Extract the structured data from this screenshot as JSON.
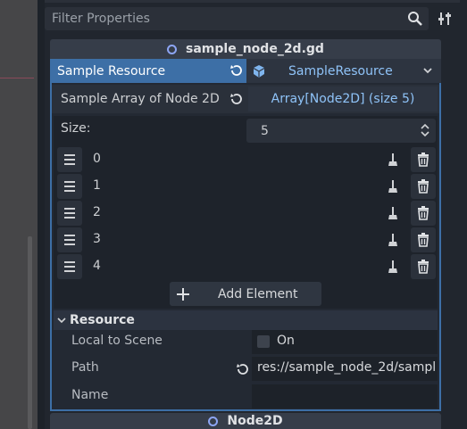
{
  "filter": {
    "placeholder": "Filter Properties"
  },
  "script_header": {
    "title": "sample_node_2d.gd"
  },
  "resource": {
    "label": "Sample Resource",
    "value": "SampleResource"
  },
  "array_prop": {
    "label": "Sample Array of Node 2D",
    "value": "Array[Node2D] (size 5)"
  },
  "size": {
    "label": "Size:",
    "value": "5"
  },
  "items": [
    {
      "index": "0"
    },
    {
      "index": "1"
    },
    {
      "index": "2"
    },
    {
      "index": "3"
    },
    {
      "index": "4"
    }
  ],
  "add_element": {
    "label": "Add Element"
  },
  "section": {
    "title": "Resource"
  },
  "props": {
    "local_to_scene": {
      "label": "Local to Scene",
      "value": "On"
    },
    "path": {
      "label": "Path",
      "value": "res://sample_node_2d/sampl"
    },
    "name": {
      "label": "Name",
      "value": ""
    }
  },
  "node_header": {
    "title": "Node2D"
  },
  "colors": {
    "accent": "#3d6fa6",
    "link_text": "#8fc3f8",
    "icon_circle": "#8da5f3"
  }
}
